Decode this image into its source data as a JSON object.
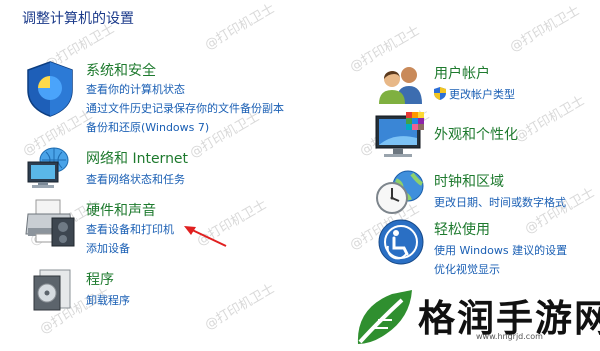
{
  "page": {
    "title": "调整计算机的设置"
  },
  "watermark": {
    "text": "@打印机卫士"
  },
  "left_column": [
    {
      "id": "system-security",
      "icon": "shield-icon",
      "title": "系统和安全",
      "links": [
        "查看你的计算机状态",
        "通过文件历史记录保存你的文件备份副本",
        "备份和还原(Windows 7)"
      ]
    },
    {
      "id": "network-internet",
      "icon": "network-icon",
      "title": "网络和 Internet",
      "links": [
        "查看网络状态和任务"
      ]
    },
    {
      "id": "hardware-sound",
      "icon": "printer-icon",
      "title": "硬件和声音",
      "links": [
        "查看设备和打印机",
        "添加设备"
      ]
    },
    {
      "id": "programs",
      "icon": "programs-icon",
      "title": "程序",
      "links": [
        "卸载程序"
      ]
    }
  ],
  "right_column": [
    {
      "id": "user-accounts",
      "icon": "users-icon",
      "title": "用户帐户",
      "links": [
        "更改帐户类型"
      ]
    },
    {
      "id": "appearance",
      "icon": "monitor-icon",
      "title": "外观和个性化",
      "links": []
    },
    {
      "id": "clock-region",
      "icon": "clock-globe-icon",
      "title": "时钟和区域",
      "links": [
        "更改日期、时间或数字格式"
      ]
    },
    {
      "id": "ease-of-access",
      "icon": "ease-of-access-icon",
      "title": "轻松使用",
      "links": [
        "使用 Windows 建议的设置",
        "优化视觉显示"
      ]
    }
  ],
  "brand": {
    "name": "格润手游网",
    "url": "www.hngrjd.com"
  },
  "colors": {
    "title": "#1b3a8a",
    "category": "#1e7a2e",
    "link": "#1a5fb4",
    "arrow": "#e02020"
  }
}
